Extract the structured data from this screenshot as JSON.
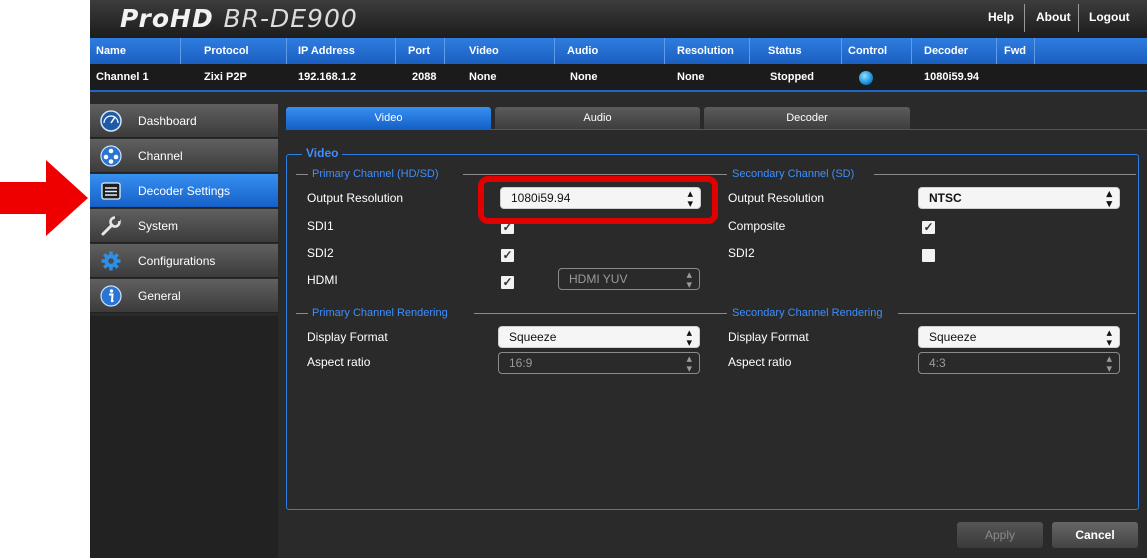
{
  "header": {
    "logo_brand": "ProHD",
    "logo_model": "BR-DE900",
    "links": [
      "Help",
      "About",
      "Logout"
    ]
  },
  "channel_table": {
    "columns": [
      "Name",
      "Protocol",
      "IP Address",
      "Port",
      "Video",
      "Audio",
      "Resolution",
      "Status",
      "Control",
      "Decoder",
      "Fwd"
    ],
    "row": {
      "name": "Channel 1",
      "protocol": "Zixi P2P",
      "ip": "192.168.1.2",
      "port": "2088",
      "video": "None",
      "audio": "None",
      "resolution": "None",
      "status": "Stopped",
      "control_icon": "play-globe-icon",
      "decoder": "1080i59.94",
      "fwd": ""
    }
  },
  "sidebar": {
    "items": [
      {
        "label": "Dashboard",
        "icon": "dashboard-icon"
      },
      {
        "label": "Channel",
        "icon": "channel-icon"
      },
      {
        "label": "Decoder Settings",
        "icon": "decoder-settings-icon",
        "active": true
      },
      {
        "label": "System",
        "icon": "wrench-icon"
      },
      {
        "label": "Configurations",
        "icon": "gear-icon"
      },
      {
        "label": "General",
        "icon": "info-icon"
      }
    ]
  },
  "tabs": [
    "Video",
    "Audio",
    "Decoder"
  ],
  "active_tab": "Video",
  "video": {
    "legend": "Video",
    "primary_channel": {
      "heading": "Primary Channel (HD/SD)",
      "output_resolution_label": "Output Resolution",
      "output_resolution_value": "1080i59.94",
      "sdi1_label": "SDI1",
      "sdi1_checked": true,
      "sdi2_label": "SDI2",
      "sdi2_checked": true,
      "hdmi_label": "HDMI",
      "hdmi_checked": true,
      "hdmi_format": "HDMI YUV"
    },
    "secondary_channel": {
      "heading": "Secondary Channel (SD)",
      "output_resolution_label": "Output Resolution",
      "output_resolution_value": "NTSC",
      "composite_label": "Composite",
      "composite_checked": true,
      "sdi2_label": "SDI2",
      "sdi2_checked": false
    },
    "primary_rendering": {
      "heading": "Primary Channel Rendering",
      "display_format_label": "Display Format",
      "display_format_value": "Squeeze",
      "aspect_ratio_label": "Aspect ratio",
      "aspect_ratio_value": "16:9"
    },
    "secondary_rendering": {
      "heading": "Secondary Channel Rendering",
      "display_format_label": "Display Format",
      "display_format_value": "Squeeze",
      "aspect_ratio_label": "Aspect ratio",
      "aspect_ratio_value": "4:3"
    }
  },
  "buttons": {
    "apply": "Apply",
    "cancel": "Cancel"
  },
  "colors": {
    "accent_blue": "#1f6fd6",
    "legend_blue": "#3d8fff",
    "highlight_red": "#e00000"
  }
}
